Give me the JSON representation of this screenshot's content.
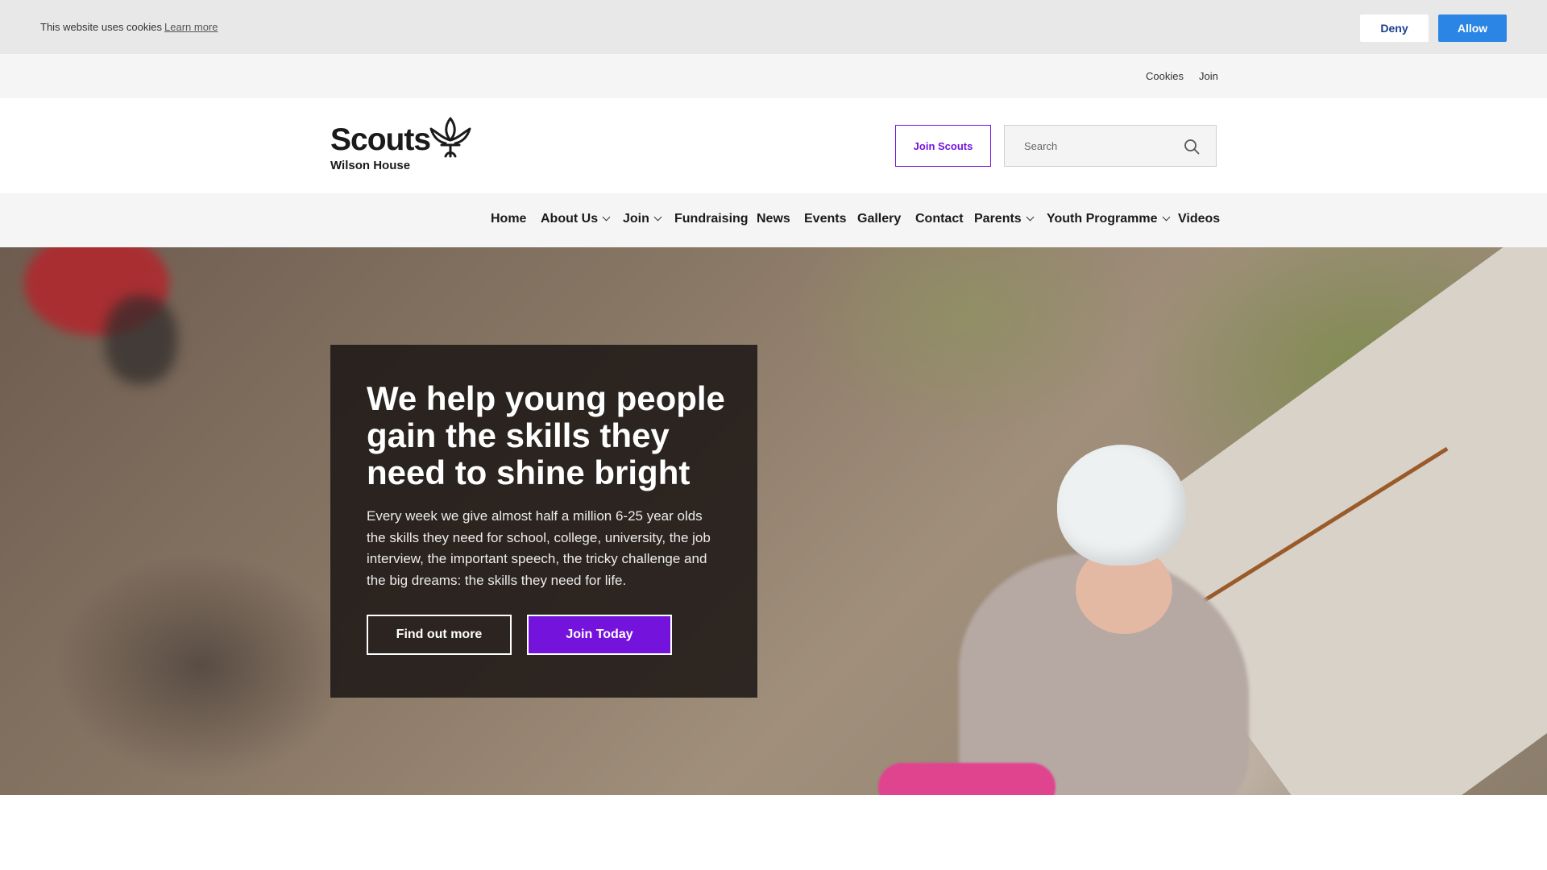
{
  "cookie_banner": {
    "text": "This website uses cookies",
    "learn_more": "Learn more",
    "deny": "Deny",
    "allow": "Allow"
  },
  "utility_nav": {
    "cookies": "Cookies",
    "join": "Join"
  },
  "header": {
    "logo_word": "Scouts",
    "logo_sub": "Wilson House",
    "join_button": "Join Scouts",
    "search_placeholder": "Search"
  },
  "nav": {
    "items": [
      {
        "label": "Home",
        "dropdown": false
      },
      {
        "label": "About Us",
        "dropdown": true
      },
      {
        "label": "Join",
        "dropdown": true
      },
      {
        "label": "Fundraising",
        "dropdown": false
      },
      {
        "label": "News",
        "dropdown": false
      },
      {
        "label": "Events",
        "dropdown": false
      },
      {
        "label": "Gallery",
        "dropdown": false
      },
      {
        "label": "Contact",
        "dropdown": false
      },
      {
        "label": "Parents",
        "dropdown": true
      },
      {
        "label": "Youth Programme",
        "dropdown": true
      },
      {
        "label": "Videos",
        "dropdown": false
      }
    ]
  },
  "hero": {
    "title": "We help young people gain the skills they need to shine bright",
    "body": "Every week we give almost half a million 6-25 year olds the skills they need for school, college, university, the job interview, the important speech, the tricky challenge and the big dreams: the skills they need for life.",
    "find_out_more": "Find out more",
    "join_today": "Join Today"
  },
  "colors": {
    "brand_purple": "#7413dc",
    "allow_blue": "#2b85e4"
  }
}
